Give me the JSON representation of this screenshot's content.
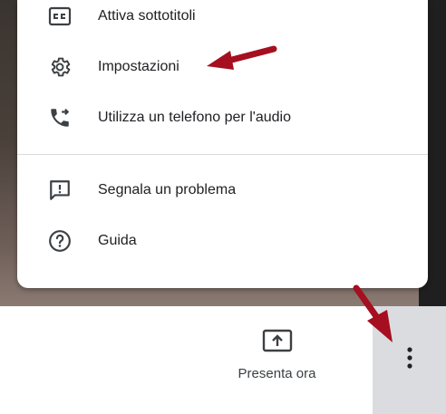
{
  "menu": {
    "items": [
      {
        "label": "Attiva sottotitoli",
        "icon": "captions-icon"
      },
      {
        "label": "Impostazioni",
        "icon": "gear-icon"
      },
      {
        "label": "Utilizza un telefono per l'audio",
        "icon": "phone-forward-icon"
      },
      {
        "label": "Segnala un problema",
        "icon": "feedback-icon"
      },
      {
        "label": "Guida",
        "icon": "help-icon"
      }
    ]
  },
  "toolbar": {
    "present_label": "Presenta ora",
    "present_icon": "present-screen-icon",
    "more_icon": "more-vert-icon"
  },
  "colors": {
    "icon": "#3c4043",
    "text": "#202124",
    "annotation_arrow": "#a50f1f",
    "more_button_bg": "#dadce0"
  }
}
